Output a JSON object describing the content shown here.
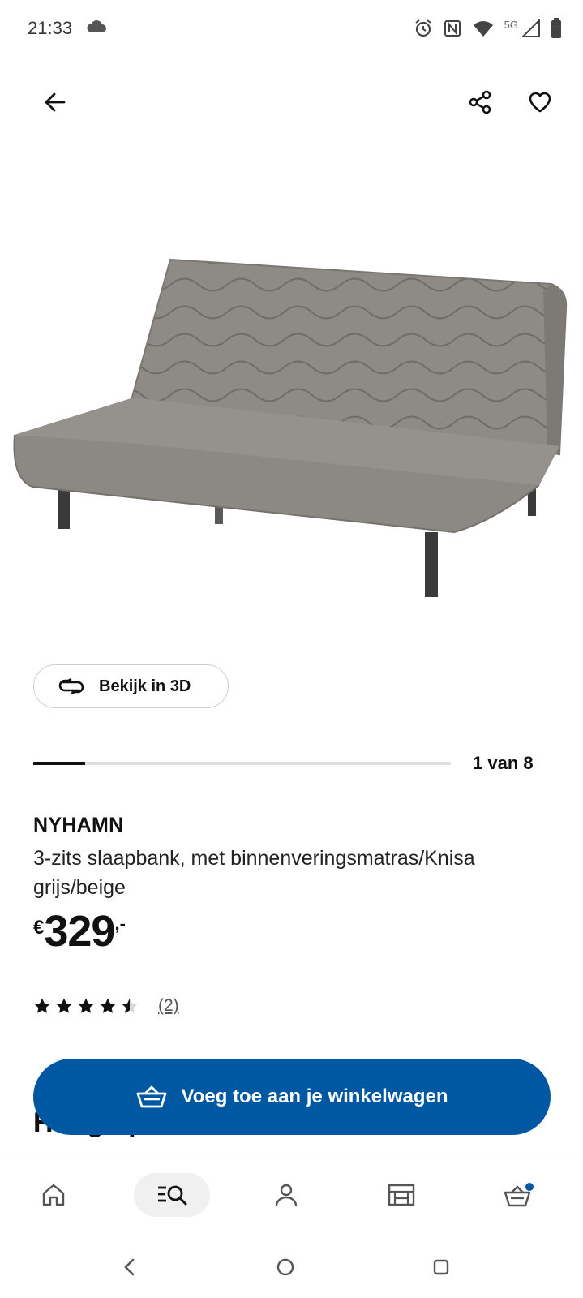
{
  "status_bar": {
    "time": "21:33",
    "network_label": "5G",
    "icons": [
      "cloud-icon",
      "alarm-icon",
      "nfc-icon",
      "wifi-icon",
      "signal-icon",
      "battery-icon"
    ]
  },
  "top_bar": {
    "icons": [
      "back-arrow-icon",
      "share-icon",
      "heart-icon"
    ]
  },
  "product": {
    "image_alt": "NYHAMN sofa bed",
    "view_3d_label": "Bekijk in 3D",
    "gallery": {
      "current": 1,
      "total": 8,
      "counter_text": "1 van 8",
      "progress_fraction": 0.125
    },
    "name": "NYHAMN",
    "description": "3-zits slaapbank, met binnenveringsmatras/Knisa grijs/beige",
    "price": {
      "currency": "€",
      "amount": "329",
      "suffix": ",-"
    },
    "rating": {
      "value": 4.5,
      "max": 5,
      "count_text": "(2)"
    },
    "partially_hidden_heading": "Hoogtepunten"
  },
  "cart_button": {
    "label": "Voeg toe aan je winkelwagen"
  },
  "bottom_nav": {
    "items": [
      {
        "id": "home",
        "icon": "home-icon",
        "active": false
      },
      {
        "id": "search",
        "icon": "search-list-icon",
        "active": true
      },
      {
        "id": "profile",
        "icon": "person-icon",
        "active": false
      },
      {
        "id": "stores",
        "icon": "store-icon",
        "active": false
      },
      {
        "id": "cart",
        "icon": "cart-icon",
        "active": false,
        "badge": true
      }
    ]
  },
  "colors": {
    "accent": "#0058a3",
    "badge": "#0058a3",
    "text": "#111111"
  }
}
